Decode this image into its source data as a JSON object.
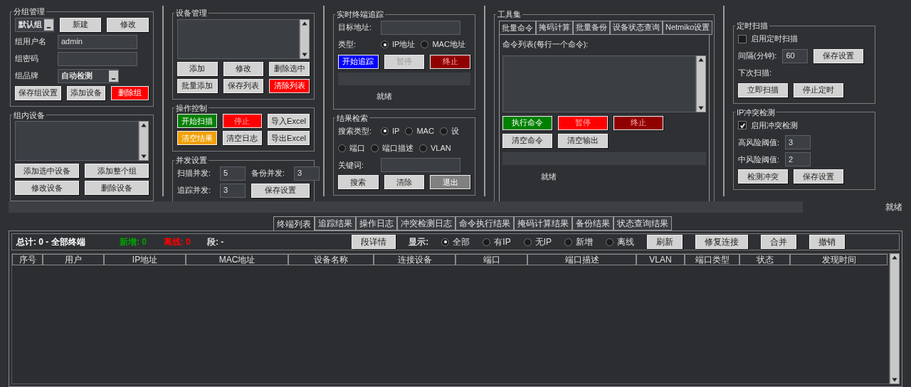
{
  "columns": [
    {
      "groups": [
        {
          "kind": "form",
          "title": "分组管理",
          "rows": [
            [
              {
                "kind": "select",
                "value": "默认组"
              },
              {
                "kind": "button",
                "label": "新建",
                "disabled": false
              },
              {
                "kind": "button",
                "label": "修改",
                "disabled": false
              }
            ],
            [
              {
                "kind": "label",
                "text": "组用户名"
              },
              {
                "kind": "field",
                "value": "admin"
              }
            ],
            [
              {
                "kind": "label",
                "text": "组密码"
              },
              {
                "kind": "field"
              }
            ],
            [
              {
                "kind": "label",
                "text": "组品牌"
              },
              {
                "kind": "select",
                "value": "自动检测"
              }
            ],
            [
              {
                "kind": "button",
                "label": "保存组设置",
                "disabled": false
              },
              {
                "kind": "button",
                "label": "添加设备",
                "disabled": false
              },
              {
                "kind": "button",
                "label": "删除组",
                "color": "#ff0000",
                "disabled": false
              }
            ]
          ]
        },
        {
          "kind": "form",
          "title": "组内设备",
          "rows": [
            [
              {
                "kind": "listbox"
              }
            ],
            [
              {
                "kind": "button",
                "label": "添加选中设备",
                "disabled": false
              },
              {
                "kind": "button",
                "label": "添加整个组",
                "disabled": false
              }
            ],
            [
              {
                "kind": "button",
                "label": "修改设备",
                "disabled": false
              },
              {
                "kind": "button",
                "label": "删除设备",
                "disabled": false
              }
            ]
          ]
        }
      ]
    },
    {
      "groups": [
        {
          "kind": "form",
          "title": "设备管理",
          "rows": [
            [
              {
                "kind": "listbox"
              }
            ],
            [
              {
                "kind": "button",
                "label": "添加",
                "disabled": false
              },
              {
                "kind": "button",
                "label": "修改",
                "disabled": false
              },
              {
                "kind": "button",
                "label": "删除选中",
                "disabled": false
              }
            ],
            [
              {
                "kind": "button",
                "label": "批量添加",
                "disabled": false
              },
              {
                "kind": "button",
                "label": "保存列表",
                "disabled": false
              },
              {
                "kind": "button",
                "label": "清除列表",
                "color": "#ff0000",
                "disabled": false
              }
            ]
          ]
        },
        {
          "kind": "form",
          "title": "操作控制",
          "rows": [
            [
              {
                "kind": "button",
                "label": "开始扫描",
                "color": "#008000",
                "disabled": false
              },
              {
                "kind": "button",
                "label": "停止",
                "color": "#ff0000",
                "disabled": true
              },
              {
                "kind": "button",
                "label": "导入Excel",
                "disabled": false
              }
            ],
            [
              {
                "kind": "button",
                "label": "清空结果",
                "color": "#f0a000",
                "disabled": false
              },
              {
                "kind": "button",
                "label": "清空日志",
                "disabled": false
              },
              {
                "kind": "button",
                "label": "导出Excel",
                "disabled": false
              }
            ]
          ]
        },
        {
          "kind": "form",
          "title": "并发设置",
          "rows": [
            [
              {
                "kind": "label",
                "text": "扫描并发:"
              },
              {
                "kind": "numfield",
                "value": "5"
              },
              {
                "kind": "label",
                "text": "备份并发:"
              },
              {
                "kind": "numfield",
                "value": "3"
              }
            ],
            [
              {
                "kind": "label",
                "text": "追踪并发:"
              },
              {
                "kind": "numfield",
                "value": "3"
              },
              {
                "kind": "button",
                "label": "保存设置",
                "disabled": false
              }
            ]
          ]
        }
      ]
    },
    {
      "groups": [
        {
          "kind": "form",
          "title": "实时终端追踪",
          "rows": [
            [
              {
                "kind": "label",
                "text": "目标地址:"
              },
              {
                "kind": "field"
              }
            ],
            [
              {
                "kind": "label",
                "text": "类型:"
              },
              {
                "kind": "radio",
                "label": "IP地址",
                "selected": true
              },
              {
                "kind": "radio",
                "label": "MAC地址",
                "selected": false
              }
            ],
            [
              {
                "kind": "button",
                "label": "开始追踪",
                "color": "#0000ff",
                "disabled": false
              },
              {
                "kind": "button",
                "label": "暂停",
                "disabled": true
              },
              {
                "kind": "button",
                "label": "终止",
                "color": "#900000",
                "disabled": true
              }
            ],
            [
              {
                "kind": "progress",
                "level": 0
              }
            ],
            [
              {
                "kind": "status",
                "text": "就绪"
              }
            ]
          ]
        },
        {
          "kind": "form",
          "title": "结果检索",
          "rows": [
            [
              {
                "kind": "label",
                "text": "搜索类型:"
              },
              {
                "kind": "radio",
                "label": "IP",
                "selected": true
              },
              {
                "kind": "radio",
                "label": "MAC",
                "selected": false
              },
              {
                "kind": "radio",
                "label": "设",
                "selected": false
              }
            ],
            [
              {
                "kind": "radio",
                "label": "端口",
                "selected": false
              },
              {
                "kind": "radio",
                "label": "端口描述",
                "selected": false
              },
              {
                "kind": "radio",
                "label": "VLAN",
                "selected": false
              }
            ],
            [
              {
                "kind": "label",
                "text": "关键词:"
              },
              {
                "kind": "field"
              }
            ],
            [
              {
                "kind": "button",
                "label": "搜索",
                "disabled": false
              },
              {
                "kind": "button",
                "label": "清除",
                "disabled": false
              },
              {
                "kind": "button",
                "label": "退出",
                "color": "#808080",
                "disabled": false
              }
            ]
          ]
        }
      ]
    },
    {
      "groups": [
        {
          "kind": "tabs",
          "title": "工具集",
          "tabs": [
            {
              "label": "批量命令",
              "selected": true
            },
            {
              "label": "掩码计算",
              "selected": false
            },
            {
              "label": "批量备份",
              "selected": false
            },
            {
              "label": "设备状态查询",
              "selected": false
            },
            {
              "label": "Netmiko设置",
              "selected": false
            }
          ],
          "rows": [
            [
              {
                "kind": "label",
                "text": "命令列表(每行一个命令):"
              }
            ],
            [
              {
                "kind": "textarea"
              }
            ],
            [
              {
                "kind": "button",
                "label": "执行命令",
                "color": "#008000",
                "disabled": false
              },
              {
                "kind": "button",
                "label": "暂停",
                "color": "#ff0000",
                "disabled": true
              },
              {
                "kind": "button",
                "label": "终止",
                "color": "#900000",
                "disabled": true
              }
            ],
            [
              {
                "kind": "button",
                "label": "清空命令",
                "disabled": false
              },
              {
                "kind": "button",
                "label": "清空输出",
                "disabled": false
              }
            ],
            [
              {
                "kind": "progress",
                "level": 0
              }
            ],
            [
              {
                "kind": "status",
                "text": "就绪"
              }
            ]
          ]
        }
      ]
    },
    {
      "groups": [
        {
          "kind": "form",
          "title": "定时扫描",
          "rows": [
            [
              {
                "kind": "checkbox",
                "label": "启用定时扫描",
                "checked": false
              }
            ],
            [
              {
                "kind": "label",
                "text": "间隔(分钟):"
              },
              {
                "kind": "numfield",
                "value": "60"
              },
              {
                "kind": "button",
                "label": "保存设置",
                "disabled": false
              }
            ],
            [
              {
                "kind": "label",
                "text": "下次扫描:"
              }
            ],
            [
              {
                "kind": "button",
                "label": "立即扫描",
                "disabled": false
              },
              {
                "kind": "button",
                "label": "停止定时",
                "disabled": false
              }
            ]
          ]
        },
        {
          "kind": "form",
          "title": "IP冲突检测",
          "rows": [
            [
              {
                "kind": "checkbox",
                "label": "启用冲突检测",
                "checked": true
              }
            ],
            [
              {
                "kind": "label",
                "text": "高风险阈值:"
              },
              {
                "kind": "numfield",
                "value": "3"
              }
            ],
            [
              {
                "kind": "label",
                "text": "中风险阈值:"
              },
              {
                "kind": "numfield",
                "value": "2"
              }
            ],
            [
              {
                "kind": "button",
                "label": "检测冲突",
                "disabled": false
              },
              {
                "kind": "button",
                "label": "保存设置",
                "disabled": false
              }
            ]
          ]
        }
      ]
    }
  ],
  "status_bar": {
    "level": 0,
    "text": "就绪"
  },
  "result_tabs": [
    {
      "label": "终端列表",
      "selected": true
    },
    {
      "label": "追踪结果",
      "selected": false
    },
    {
      "label": "操作日志",
      "selected": false
    },
    {
      "label": "冲突检测日志",
      "selected": false
    },
    {
      "label": "命令执行结果",
      "selected": false
    },
    {
      "label": "掩码计算结果",
      "selected": false
    },
    {
      "label": "备份结果",
      "selected": false
    },
    {
      "label": "状态查询结果",
      "selected": false
    }
  ],
  "summary": [
    {
      "text": "总计: 0 - 全部终端",
      "color": "#ffffff"
    },
    {
      "text": "新增: 0",
      "color": "#00a000"
    },
    {
      "text": "离线: 0",
      "color": "#ff0000"
    },
    {
      "text": "段: -",
      "color": "#e0e0e0"
    }
  ],
  "toolbar": [
    {
      "kind": "button",
      "label": "段详情",
      "disabled": false
    },
    {
      "kind": "label",
      "text": "显示:"
    },
    {
      "kind": "radio",
      "label": "全部",
      "selected": true
    },
    {
      "kind": "radio",
      "label": "有IP",
      "selected": false
    },
    {
      "kind": "radio",
      "label": "无IP",
      "selected": false
    },
    {
      "kind": "radio",
      "label": "新增",
      "selected": false
    },
    {
      "kind": "radio",
      "label": "离线",
      "selected": false
    },
    {
      "kind": "button",
      "label": "刷新",
      "disabled": false
    },
    {
      "kind": "button",
      "label": "修复连接",
      "disabled": false
    },
    {
      "kind": "button",
      "label": "合并",
      "disabled": false
    },
    {
      "kind": "button",
      "label": "撤销",
      "disabled": false
    }
  ],
  "table": {
    "columns": [
      "序号",
      "用户",
      "IP地址",
      "MAC地址",
      "设备名称",
      "连接设备",
      "端口",
      "端口描述",
      "VLAN",
      "端口类型",
      "状态",
      "发现时间"
    ]
  }
}
